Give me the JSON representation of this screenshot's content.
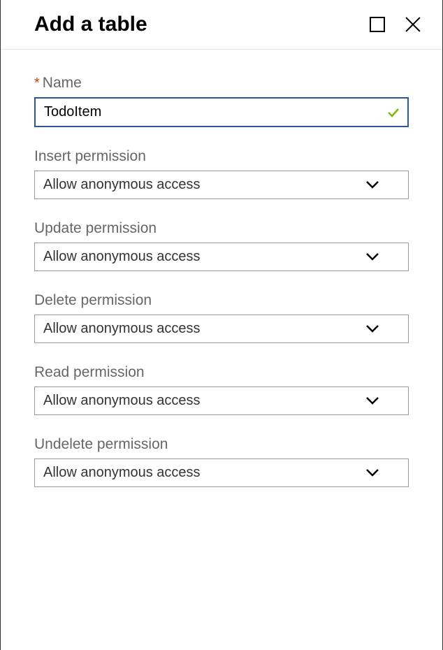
{
  "header": {
    "title": "Add a table"
  },
  "name": {
    "label": "Name",
    "required": "*",
    "value": "TodoItem"
  },
  "permissions": [
    {
      "label": "Insert permission",
      "value": "Allow anonymous access"
    },
    {
      "label": "Update permission",
      "value": "Allow anonymous access"
    },
    {
      "label": "Delete permission",
      "value": "Allow anonymous access"
    },
    {
      "label": "Read permission",
      "value": "Allow anonymous access"
    },
    {
      "label": "Undelete permission",
      "value": "Allow anonymous access"
    }
  ]
}
